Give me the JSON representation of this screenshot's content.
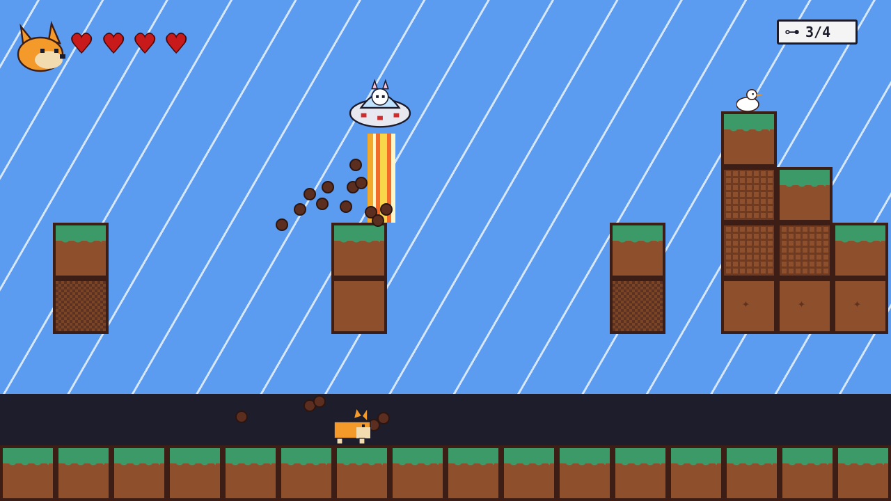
{
  "hud": {
    "player_portrait_icon": "fox-head-icon",
    "hearts": {
      "current": 4,
      "max": 4,
      "icon": "heart-icon"
    },
    "collectible_counter": {
      "icon": "bone-icon",
      "text": "3/4",
      "collected": 3,
      "total": 4
    }
  },
  "colors": {
    "sky": "#5b9bf0",
    "sky_stripes": "#ffffff",
    "cave": "#1e1d2b",
    "grass": "#3c9a68",
    "dirt": "#8d4f2c",
    "outline": "#3c1e16",
    "heart": "#c81a1a"
  },
  "sprites": {
    "player": "corgi-dog",
    "enemy": "cat-in-ufo",
    "npc": "white-seagull",
    "effects": [
      "rainbow-thrust-beam",
      "dirt-particles"
    ]
  }
}
